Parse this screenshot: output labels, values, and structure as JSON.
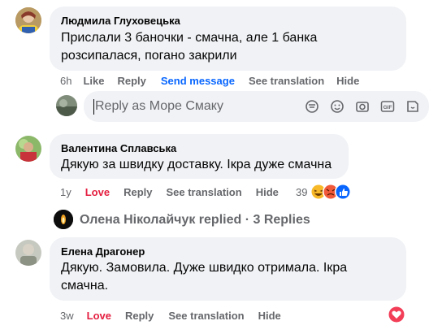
{
  "comments": [
    {
      "author": "Людмила Глуховецька",
      "text_lines": [
        "Прислали 3 баночки - смачна, але 1 банка",
        "розсипалася, погано закрили"
      ],
      "time": "6h",
      "actions": [
        "Like",
        "Reply",
        "Send message",
        "See translation",
        "Hide"
      ]
    },
    {
      "author": "Валентина Сплавська",
      "text_lines": [
        "Дякую за швидку доставку. Ікра дуже смачна"
      ],
      "time": "1y",
      "actions": [
        "Love",
        "Reply",
        "See translation",
        "Hide"
      ],
      "reaction_count": "39"
    },
    {
      "author": "Елена Драгонер",
      "text_lines": [
        "Дякую. Замовила. Дуже швидко отримала. Ікра",
        "смачна."
      ],
      "time": "3w",
      "actions": [
        "Love",
        "Reply",
        "See translation",
        "Hide"
      ]
    }
  ],
  "reply_box": {
    "placeholder": "Reply as Море Смаку",
    "tools": [
      "sticker-icon",
      "emoji-icon",
      "camera-icon",
      "gif-icon",
      "sticker-alt-icon"
    ]
  },
  "replies_thread": {
    "text": "Олена Ніколайчук replied · 3 Replies"
  },
  "colors": {
    "bubble": "#f0f2f5",
    "link_blue": "#0866ff",
    "love_red": "#e41e3f",
    "meta_gray": "#65676b"
  }
}
